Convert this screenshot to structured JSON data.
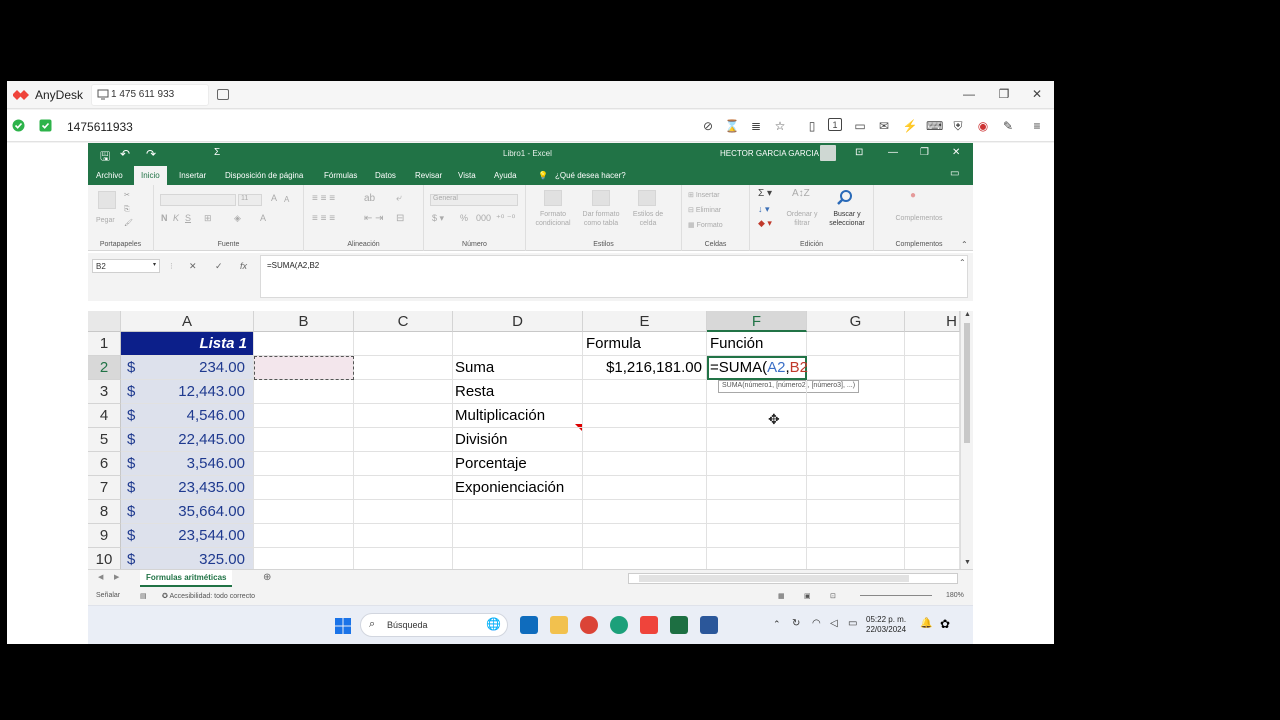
{
  "anydesk": {
    "app_name": "AnyDesk",
    "tab_label": "1 475 611 933",
    "address": "1475611933"
  },
  "excel": {
    "doc_title": "Libro1  -  Excel",
    "user": "HECTOR GARCIA GARCIA",
    "menu_tabs": [
      "Archivo",
      "Inicio",
      "Insertar",
      "Disposición de página",
      "Fórmulas",
      "Datos",
      "Revisar",
      "Vista",
      "Ayuda"
    ],
    "tell_me": "¿Qué desea hacer?",
    "ribbon_groups": {
      "clipboard": "Portapapeles",
      "font": "Fuente",
      "alignment": "Alineación",
      "number": "Número",
      "styles": "Estilos",
      "cells": "Celdas",
      "editing": "Edición",
      "addins": "Complementos"
    },
    "ribbon_items": {
      "paste": "Pegar",
      "font_name": "",
      "font_size": "11",
      "number_format": "General",
      "cond_format_1": "Formato",
      "cond_format_2": "condicional",
      "format_table_1": "Dar formato",
      "format_table_2": "como tabla",
      "cell_styles_1": "Estilos de",
      "cell_styles_2": "celda",
      "insert": "Insertar",
      "delete": "Eliminar",
      "format": "Formato",
      "sort_1": "Ordenar y",
      "sort_2": "filtrar",
      "find_1": "Buscar y",
      "find_2": "seleccionar",
      "addins_btn": "Complementos"
    },
    "name_box": "B2",
    "formula": "=SUMA(A2,B2",
    "columns": [
      "A",
      "B",
      "C",
      "D",
      "E",
      "F",
      "G",
      "H"
    ],
    "rows": [
      "1",
      "2",
      "3",
      "4",
      "5",
      "6",
      "7",
      "8",
      "9",
      "10"
    ],
    "a_header": "Lista 1",
    "currency": "$",
    "a_values": [
      "234.00",
      "12,443.00",
      "4,546.00",
      "22,445.00",
      "3,546.00",
      "23,435.00",
      "35,664.00",
      "23,544.00",
      "325.00"
    ],
    "d_values": [
      "Suma",
      "Resta",
      "Multiplicación",
      "División",
      "Porcentaje",
      "Exponienciación"
    ],
    "e1": "Formula",
    "f1": "Función",
    "e2": "$1,216,181.00",
    "f2_prefix": "=SUMA(",
    "f2_a": "A2",
    "f2_sep": ",",
    "f2_b": "B2",
    "tooltip": "SUMA(número1, [número2], [número3], ...)",
    "sheet_tab": "Formulas aritméticas",
    "status_left": "Señalar",
    "accessibility": "Accesibilidad: todo correcto",
    "zoom": "180%",
    "search_placeholder": "Búsqueda",
    "time": "05:22 p. m.",
    "date": "22/03/2024"
  }
}
